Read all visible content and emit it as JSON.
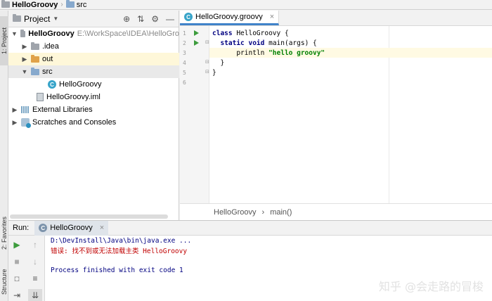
{
  "breadcrumb": {
    "project": "HelloGroovy",
    "folder": "src"
  },
  "side_tabs": {
    "project": "1: Project",
    "favorites": "2: Favorites",
    "structure": "Structure"
  },
  "project_panel": {
    "title": "Project",
    "tree": [
      {
        "label": "HelloGroovy",
        "extra": "E:\\WorkSpace\\IDEA\\HelloGro"
      },
      {
        "label": ".idea"
      },
      {
        "label": "out"
      },
      {
        "label": "src"
      },
      {
        "label": "HelloGroovy"
      },
      {
        "label": "HelloGroovy.iml"
      },
      {
        "label": "External Libraries"
      },
      {
        "label": "Scratches and Consoles"
      }
    ]
  },
  "editor": {
    "tab_label": "HelloGroovy.groovy",
    "lines": [
      {
        "num": "1",
        "code": [
          {
            "t": "class ",
            "k": "kw"
          },
          {
            "t": "HelloGroovy {",
            "k": ""
          }
        ]
      },
      {
        "num": "2",
        "code": [
          {
            "t": "  ",
            "k": ""
          },
          {
            "t": "static void ",
            "k": "kw"
          },
          {
            "t": "main(args) {",
            "k": ""
          }
        ]
      },
      {
        "num": "3",
        "code": [
          {
            "t": "      println ",
            "k": ""
          },
          {
            "t": "\"hello groovy\"",
            "k": "str"
          }
        ]
      },
      {
        "num": "4",
        "code": [
          {
            "t": "  }",
            "k": ""
          }
        ]
      },
      {
        "num": "5",
        "code": [
          {
            "t": "}",
            "k": ""
          }
        ]
      },
      {
        "num": "6",
        "code": []
      }
    ],
    "crumbs": {
      "class": "HelloGroovy",
      "method": "main()"
    }
  },
  "run_panel": {
    "label": "Run:",
    "tab_label": "HelloGroovy",
    "console": [
      {
        "text": "D:\\DevInstall\\Java\\bin\\java.exe ...",
        "kind": "c-cmd"
      },
      {
        "text": "错误: 找不到或无法加载主类 HelloGroovy",
        "kind": "c-err"
      },
      {
        "text": "",
        "kind": ""
      },
      {
        "text": "Process finished with exit code 1",
        "kind": "c-ok"
      }
    ]
  },
  "watermark": "知乎 @会走路的冒梭"
}
